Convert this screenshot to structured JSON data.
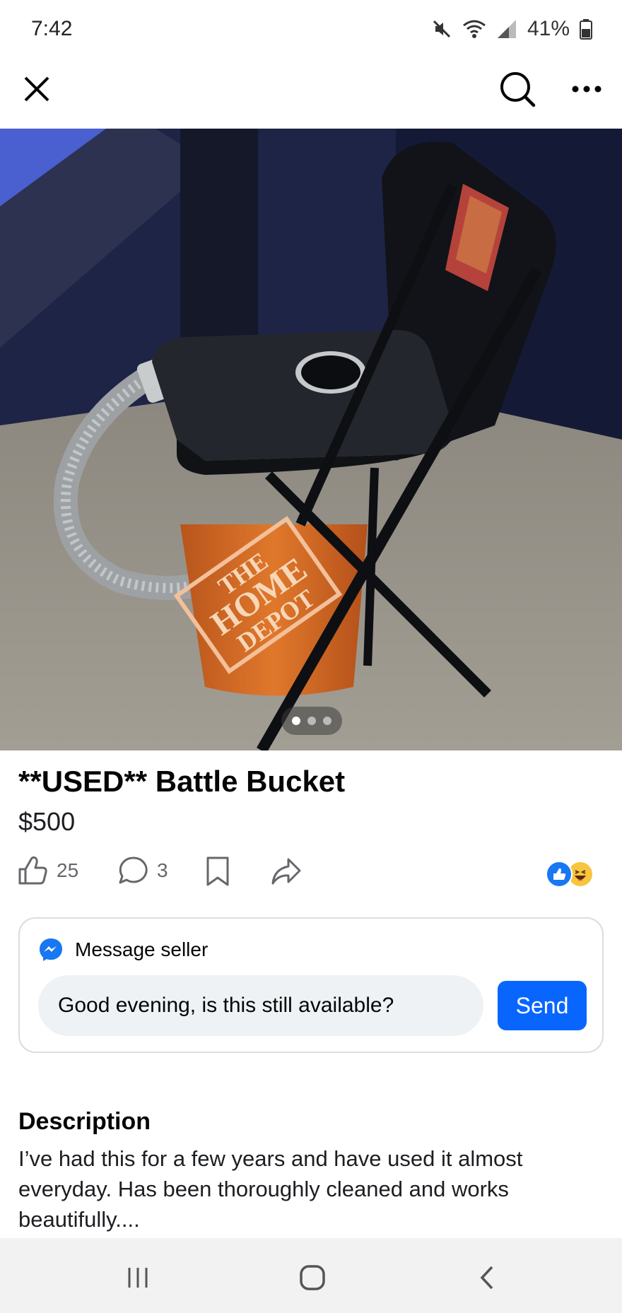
{
  "status_bar": {
    "time": "7:42",
    "battery_percent": "41%",
    "icons": [
      "mute-icon",
      "wifi-icon",
      "signal-icon",
      "battery-icon"
    ]
  },
  "app_bar": {
    "icons": [
      "close-icon",
      "search-icon",
      "more-icon"
    ]
  },
  "photo": {
    "carousel_total": 3,
    "carousel_active_index": 0,
    "bucket_text": [
      "THE",
      "HOME",
      "DEPOT"
    ]
  },
  "listing": {
    "title": "**USED** Battle Bucket",
    "price": "$500"
  },
  "actions": {
    "like_count": "25",
    "comment_count": "3",
    "icons": [
      "like-icon",
      "comment-icon",
      "save-icon",
      "share-icon"
    ],
    "reactions": [
      "like-reaction-icon",
      "haha-reaction-icon"
    ]
  },
  "message_seller": {
    "label": "Message seller",
    "input_value": "Good evening, is this still available?",
    "send_label": "Send"
  },
  "description": {
    "heading": "Description",
    "text": "I’ve had this for a few years and have used it almost everyday. Has been thoroughly cleaned and works beautifully...."
  },
  "nav_bar": {
    "icons": [
      "recents-icon",
      "home-icon",
      "back-icon"
    ]
  },
  "colors": {
    "accent": "#0866ff",
    "text_primary": "#050505",
    "text_secondary": "#65676b",
    "input_bg": "#eef2f4",
    "card_border": "#dadde1",
    "nav_bg": "#f2f2f2"
  }
}
